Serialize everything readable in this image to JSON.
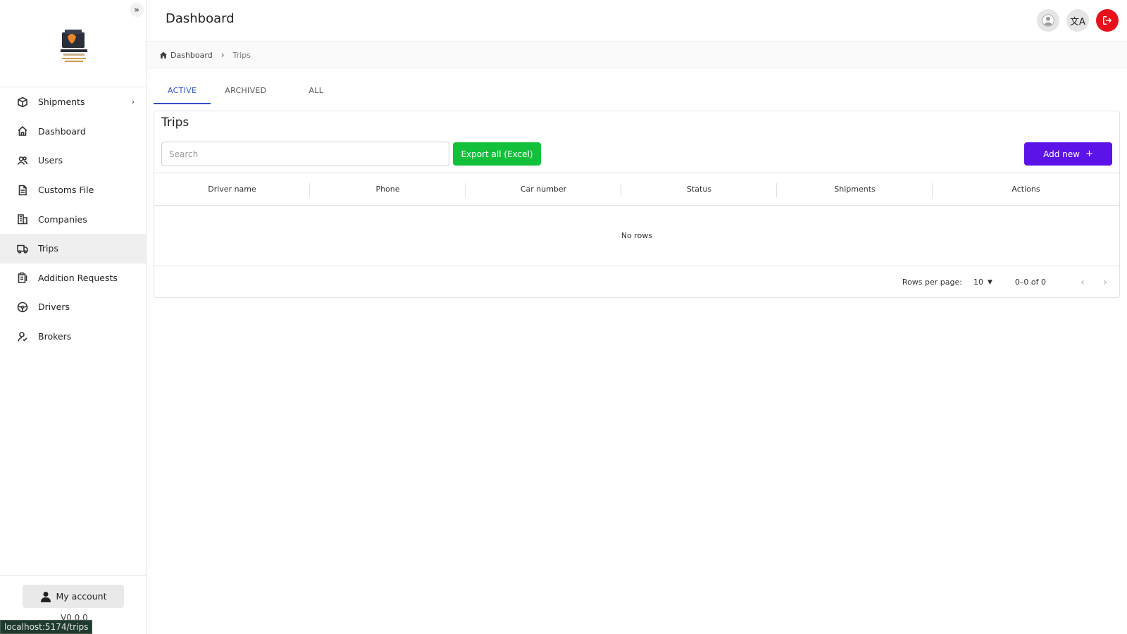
{
  "sidebar": {
    "collapse_icon": "»",
    "items": [
      {
        "label": "Shipments",
        "icon": "box-icon",
        "has_submenu": true
      },
      {
        "label": "Dashboard",
        "icon": "home-icon"
      },
      {
        "label": "Users",
        "icon": "users-icon"
      },
      {
        "label": "Customs File",
        "icon": "file-icon"
      },
      {
        "label": "Companies",
        "icon": "building-icon"
      },
      {
        "label": "Trips",
        "icon": "truck-icon",
        "active": true
      },
      {
        "label": "Addition Requests",
        "icon": "clipboard-icon"
      },
      {
        "label": "Drivers",
        "icon": "steering-wheel-icon"
      },
      {
        "label": "Brokers",
        "icon": "broker-icon"
      }
    ],
    "my_account_label": "My account",
    "version": "V0.0.0"
  },
  "status_url": "localhost:5174/trips",
  "header": {
    "title": "Dashboard",
    "lang_icon": "文A",
    "colors": {
      "logout": "#e8101b"
    }
  },
  "breadcrumb": {
    "home_label": "Dashboard",
    "current": "Trips"
  },
  "tabs": [
    {
      "label": "ACTIVE",
      "active": true
    },
    {
      "label": "ARCHIVED"
    },
    {
      "label": "ALL"
    }
  ],
  "main": {
    "card_title": "Trips",
    "search_placeholder": "Search",
    "export_label": "Export all (Excel)",
    "add_label": "Add new",
    "add_icon": "+",
    "colors": {
      "export": "#12c03a",
      "add": "#5b13e8",
      "active_tab": "#2f52c7"
    },
    "table": {
      "columns": [
        "Driver name",
        "Phone",
        "Car number",
        "Status",
        "Shipments",
        "Actions"
      ],
      "empty_message": "No rows"
    },
    "pagination": {
      "rows_per_page_label": "Rows per page:",
      "rows_per_page": "10",
      "range": "0–0 of 0"
    }
  }
}
